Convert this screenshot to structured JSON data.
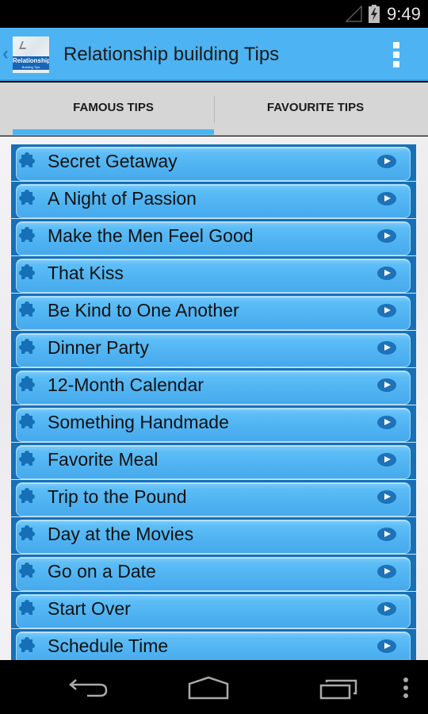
{
  "status_bar": {
    "time": "9:49",
    "icons": [
      "signal-icon",
      "battery-charging-icon"
    ]
  },
  "action_bar": {
    "title": "Relationship building Tips",
    "logo_text_line1": "Relationship",
    "logo_text_line2": "Building Tips",
    "icons": [
      "up-caret-icon",
      "app-logo",
      "overflow-menu-icon"
    ]
  },
  "tabs": [
    {
      "label": "FAMOUS TIPS",
      "selected": true
    },
    {
      "label": "FAVOURITE TIPS",
      "selected": false
    }
  ],
  "tips": [
    {
      "title": "Secret Getaway"
    },
    {
      "title": "A Night of Passion"
    },
    {
      "title": "Make the Men Feel Good"
    },
    {
      "title": "That Kiss"
    },
    {
      "title": "Be Kind to One Another"
    },
    {
      "title": "Dinner Party"
    },
    {
      "title": "12-Month Calendar"
    },
    {
      "title": "Something Handmade"
    },
    {
      "title": "Favorite Meal"
    },
    {
      "title": "Trip to the Pound"
    },
    {
      "title": "Day at the Movies"
    },
    {
      "title": "Go on a Date"
    },
    {
      "title": "Start Over"
    },
    {
      "title": "Schedule Time"
    }
  ],
  "item_icons": {
    "leading": "puzzle-piece-icon",
    "trailing": "play-arrow-icon"
  },
  "nav_bar": {
    "buttons": [
      "back-icon",
      "home-icon",
      "recent-apps-icon",
      "menu-icon"
    ]
  },
  "colors": {
    "accent": "#4db3f2",
    "item_dark": "#1670b8",
    "tab_background": "#d6d6d6"
  }
}
